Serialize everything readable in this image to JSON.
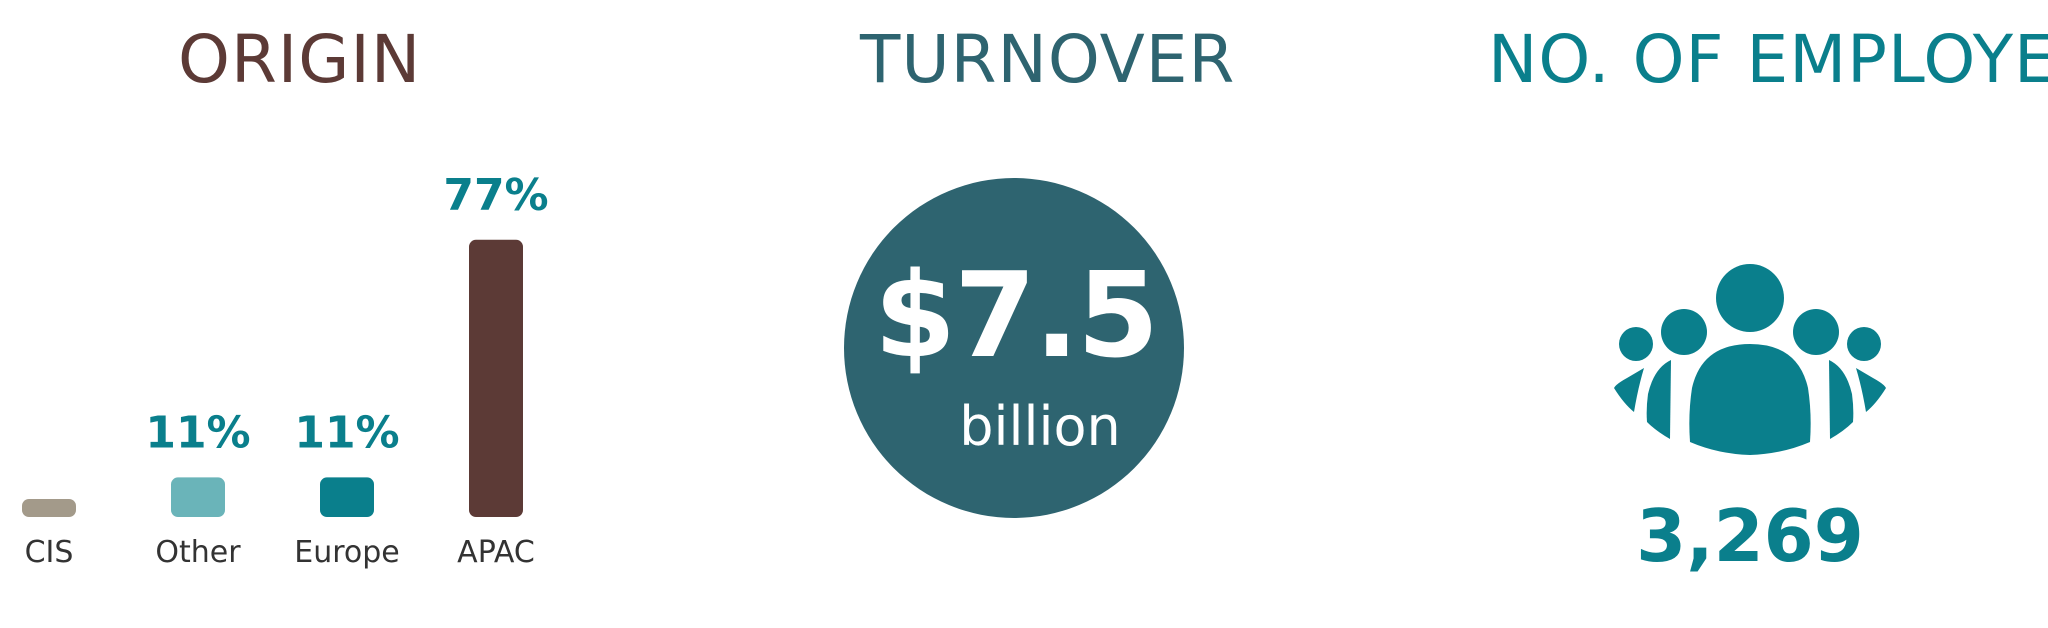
{
  "origin": {
    "title": "ORIGIN"
  },
  "turnover": {
    "title": "TURNOVER",
    "value": "$7.5",
    "unit": "billion"
  },
  "employees": {
    "title": "NO. OF EMPLOYEES",
    "value": "3,269",
    "icon": "people-group-icon"
  },
  "colors": {
    "cis": "#a39a8a",
    "other": "#6ab4b9",
    "europe": "#0a7f8c",
    "apac": "#5c3a36",
    "value_label": "#0a7f8c",
    "turnover_circle": "#2e6470",
    "origin_title": "#5c3a36",
    "turnover_title": "#2e6470",
    "employees_title": "#0a7f8c"
  },
  "chart_data": {
    "type": "bar",
    "title": "ORIGIN",
    "categories": [
      "CIS",
      "Other",
      "Europe",
      "APAC"
    ],
    "values": [
      5,
      11,
      11,
      77
    ],
    "value_labels": [
      "",
      "11%",
      "11%",
      "77%"
    ],
    "unit": "%",
    "ylim": [
      0,
      80
    ],
    "grid": false,
    "legend": "none"
  }
}
